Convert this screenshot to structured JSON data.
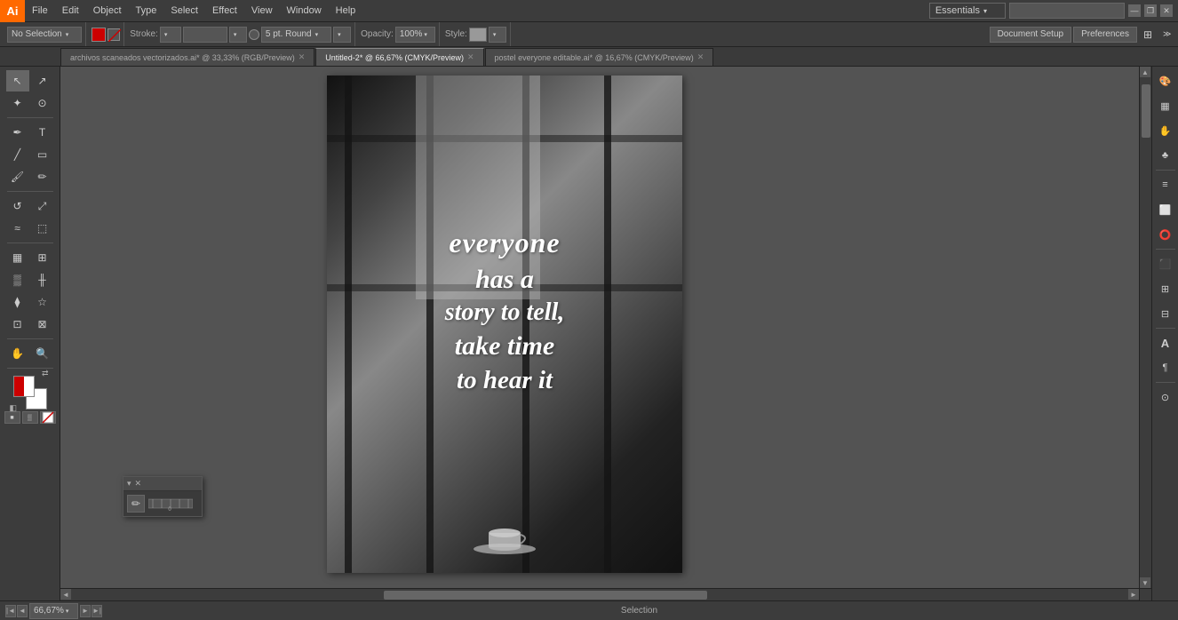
{
  "app": {
    "logo": "Ai",
    "logo_bg": "#FF6900"
  },
  "menu": {
    "items": [
      "File",
      "Edit",
      "Object",
      "Type",
      "Select",
      "Effect",
      "View",
      "Window",
      "Help"
    ]
  },
  "workspace": {
    "label": "Essentials",
    "search_placeholder": ""
  },
  "window_controls": {
    "minimize": "—",
    "restore": "❐",
    "close": "✕"
  },
  "toolbar_top": {
    "selection_label": "No Selection",
    "stroke_label": "Stroke:",
    "stroke_value": "",
    "brush_size": "5 pt. Round",
    "opacity_label": "Opacity:",
    "opacity_value": "100%",
    "style_label": "Style:",
    "doc_setup_label": "Document Setup",
    "preferences_label": "Preferences"
  },
  "tabs": [
    {
      "label": "archivos scaneados vectorizados.ai* @ 33,33% (RGB/Preview)",
      "active": false
    },
    {
      "label": "Untitled-2* @ 66,67% (CMYK/Preview)",
      "active": true
    },
    {
      "label": "postel everyone editable.ai* @ 16,67% (CMYK/Preview)",
      "active": false
    }
  ],
  "canvas": {
    "zoom_value": "66,67%",
    "status_label": "Selection"
  },
  "quote_text": "everyone\nhas a\nstory to tell,\ntake time\nto hear it",
  "float_panel": {
    "close_btn": "✕",
    "collapse_btn": "▾",
    "ruler_icon": "📏"
  },
  "right_panel": {
    "icons": [
      "🎨",
      "▦",
      "✋",
      "♣",
      "≡",
      "⬜",
      "⭕",
      "⬛",
      "A",
      "¶",
      "⊙"
    ]
  },
  "bottom_bar": {
    "zoom": "66,67%",
    "status": "Selection"
  },
  "tools": {
    "left": [
      {
        "name": "selection-tool",
        "icon": "↖"
      },
      {
        "name": "direct-selection-tool",
        "icon": "↗"
      },
      {
        "name": "magic-wand-tool",
        "icon": "✦"
      },
      {
        "name": "lasso-tool",
        "icon": "⊙"
      },
      {
        "name": "pen-tool",
        "icon": "✒"
      },
      {
        "name": "type-tool",
        "icon": "T"
      },
      {
        "name": "line-tool",
        "icon": "╱"
      },
      {
        "name": "rectangle-tool",
        "icon": "▭"
      },
      {
        "name": "paintbrush-tool",
        "icon": "🖌"
      },
      {
        "name": "pencil-tool",
        "icon": "✏"
      },
      {
        "name": "rotate-tool",
        "icon": "↺"
      },
      {
        "name": "mirror-tool",
        "icon": "⇋"
      },
      {
        "name": "scale-tool",
        "icon": "⤢"
      },
      {
        "name": "warp-tool",
        "icon": "≈"
      },
      {
        "name": "graph-tool",
        "icon": "▦"
      },
      {
        "name": "mesh-tool",
        "icon": "⊞"
      },
      {
        "name": "gradient-tool",
        "icon": "▒"
      },
      {
        "name": "eyedropper-tool",
        "icon": "💉"
      },
      {
        "name": "blend-tool",
        "icon": "⧫"
      },
      {
        "name": "symbol-tool",
        "icon": "☆"
      },
      {
        "name": "column-graph-tool",
        "icon": "▮"
      },
      {
        "name": "artboard-tool",
        "icon": "⬚"
      },
      {
        "name": "slice-tool",
        "icon": "⊡"
      },
      {
        "name": "hand-tool",
        "icon": "✋"
      },
      {
        "name": "zoom-tool",
        "icon": "🔍"
      }
    ]
  }
}
